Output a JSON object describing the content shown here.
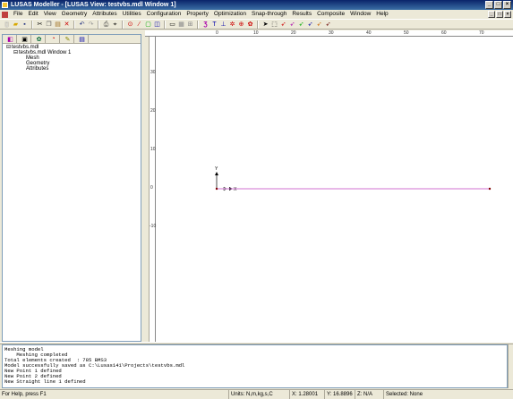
{
  "title_bar": {
    "title": "LUSAS Modeller - [LUSAS View: testvbs.mdl Window 1]"
  },
  "menu": {
    "items": [
      "File",
      "Edit",
      "View",
      "Geometry",
      "Attributes",
      "Utilities",
      "Configuration",
      "Property",
      "Optimization",
      "Snap-through",
      "Results",
      "Composite",
      "Window",
      "Help"
    ]
  },
  "tree": {
    "root": "testvbs.mdl",
    "window": "testvbs.mdl Window 1",
    "children": [
      "Mesh",
      "Geometry",
      "Attributes"
    ]
  },
  "view": {
    "ruler_top_ticks": [
      "0",
      "10",
      "20",
      "30",
      "40",
      "50",
      "60",
      "70"
    ],
    "ruler_left_ticks": [
      "30",
      "20",
      "10",
      "0",
      "-10"
    ],
    "axis_y_label": "Y",
    "axis_x_label": "X"
  },
  "output": {
    "lines": [
      "Meshing model",
      "    Meshing completed",
      "Total elements created  : 785 BMS3",
      "Model successfully saved as C:\\Lusas141\\Projects\\testvbs.mdl",
      "New Point 1 defined",
      "New Point 2 defined",
      "New Straight line 1 defined"
    ]
  },
  "status": {
    "help": "For Help, press F1",
    "units": "Units: N,m,kg,s,C",
    "x": "X: 1.28001",
    "y": "Y: 16.8896",
    "z": "Z: N/A",
    "selected": "Selected: None"
  },
  "colors": {
    "line": "#d070d0",
    "point": "#800000"
  }
}
